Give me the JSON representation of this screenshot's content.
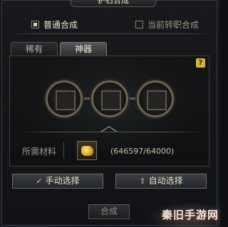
{
  "window": {
    "title": "护石合成"
  },
  "modes": [
    {
      "label": "普通合成",
      "selected": true
    },
    {
      "label": "当前转职合成",
      "selected": false
    }
  ],
  "tabs": [
    {
      "label": "稀有",
      "active": false
    },
    {
      "label": "神器",
      "active": true
    }
  ],
  "help": {
    "label": "?"
  },
  "materials": {
    "label": "所需材料",
    "quantity": "(646597/64000)",
    "item_icon": "gold-coins-icon"
  },
  "buttons": {
    "manual": "手动选择",
    "auto": "自动选择",
    "combine": "合成"
  },
  "watermark": {
    "text": "秦旧手游网"
  },
  "colors": {
    "accent": "#d9b336",
    "text": "#efe6cf"
  }
}
